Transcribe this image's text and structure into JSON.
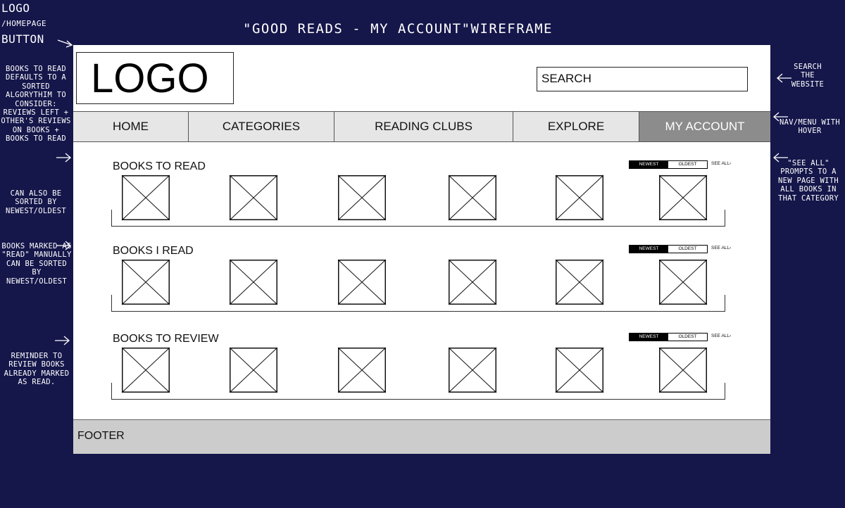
{
  "page_title": "\"GOOD READS - MY ACCOUNT\"WIREFRAME",
  "annotations": {
    "logo": {
      "line1": "LOGO",
      "line2": "/HOMEPAGE",
      "line3": "BUTTON"
    },
    "books_to_read": "BOOKS TO READ DEFAULTS TO A SORTED ALGORYTHIM TO CONSIDER: REVIEWS LEFT + OTHER'S REVIEWS ON BOOKS + BOOKS TO READ",
    "books_to_read_sort": "CAN ALSO BE SORTED BY NEWEST/OLDEST",
    "books_read": "BOOKS MARKED AS \"READ\" MANUALLY CAN BE SORTED BY NEWEST/OLDEST",
    "books_review": "REMINDER TO REVIEW BOOKS ALREADY MARKED AS READ.",
    "search": "SEARCH THE WEBSITE",
    "nav": "NAV/MENU WITH HOVER",
    "see_all": "\"SEE ALL\" PROMPTS TO A NEW PAGE WITH ALL BOOKS IN THAT CATEGORY"
  },
  "header": {
    "logo": "LOGO",
    "search_placeholder": "SEARCH"
  },
  "nav": {
    "items": [
      "HOME",
      "CATEGORIES",
      "READING CLUBS",
      "EXPLORE",
      "MY ACCOUNT"
    ],
    "active": "MY ACCOUNT"
  },
  "sections": [
    {
      "title": "BOOKS TO READ",
      "sort_newest": "NEWEST",
      "sort_oldest": "OLDEST",
      "see_all": "SEE ALL",
      "sort_selected": "NEWEST",
      "placeholder_count": 6
    },
    {
      "title": "BOOKS I READ",
      "sort_newest": "NEWEST",
      "sort_oldest": "OLDEST",
      "see_all": "SEE ALL",
      "sort_selected": "NEWEST",
      "placeholder_count": 6
    },
    {
      "title": "BOOKS TO REVIEW",
      "sort_newest": "NEWEST",
      "sort_oldest": "OLDEST",
      "see_all": "SEE ALL",
      "sort_selected": "NEWEST",
      "placeholder_count": 6
    }
  ],
  "footer": {
    "label": "FOOTER"
  },
  "colors": {
    "background": "#15164a",
    "nav_active": "#8c8c8c",
    "nav_inactive": "#e6e6e6",
    "footer": "#cccccc"
  }
}
